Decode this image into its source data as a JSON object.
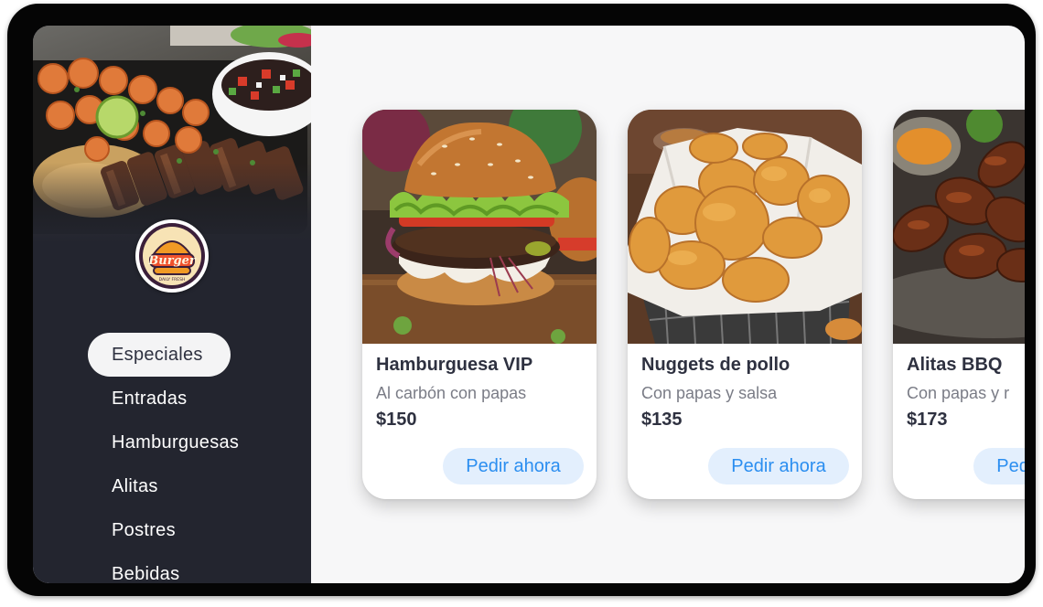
{
  "brand": {
    "logo_alt": "Burger Daily Fresh logo",
    "logo_word": "Burger",
    "logo_sub": "DAILY FRESH"
  },
  "sidebar": {
    "items": [
      {
        "label": "Especiales",
        "active": true
      },
      {
        "label": "Entradas",
        "active": false
      },
      {
        "label": "Hamburguesas",
        "active": false
      },
      {
        "label": "Alitas",
        "active": false
      },
      {
        "label": "Postres",
        "active": false
      },
      {
        "label": "Bebidas",
        "active": false
      }
    ]
  },
  "products": [
    {
      "title": "Hamburguesa VIP",
      "description": "Al carbón con papas",
      "price": "$150",
      "button": "Pedir ahora",
      "image": "burger-photo"
    },
    {
      "title": "Nuggets de pollo",
      "description": "Con papas y salsa",
      "price": "$135",
      "button": "Pedir ahora",
      "image": "nuggets-photo"
    },
    {
      "title": "Alitas BBQ",
      "description": "Con papas y r",
      "price": "$173",
      "button": "Pedir ahora",
      "image": "wings-photo"
    }
  ],
  "colors": {
    "sidebar_bg": "#23252f",
    "content_bg": "#f7f7f8",
    "accent": "#2b8ef0",
    "button_bg": "#e3effd"
  }
}
